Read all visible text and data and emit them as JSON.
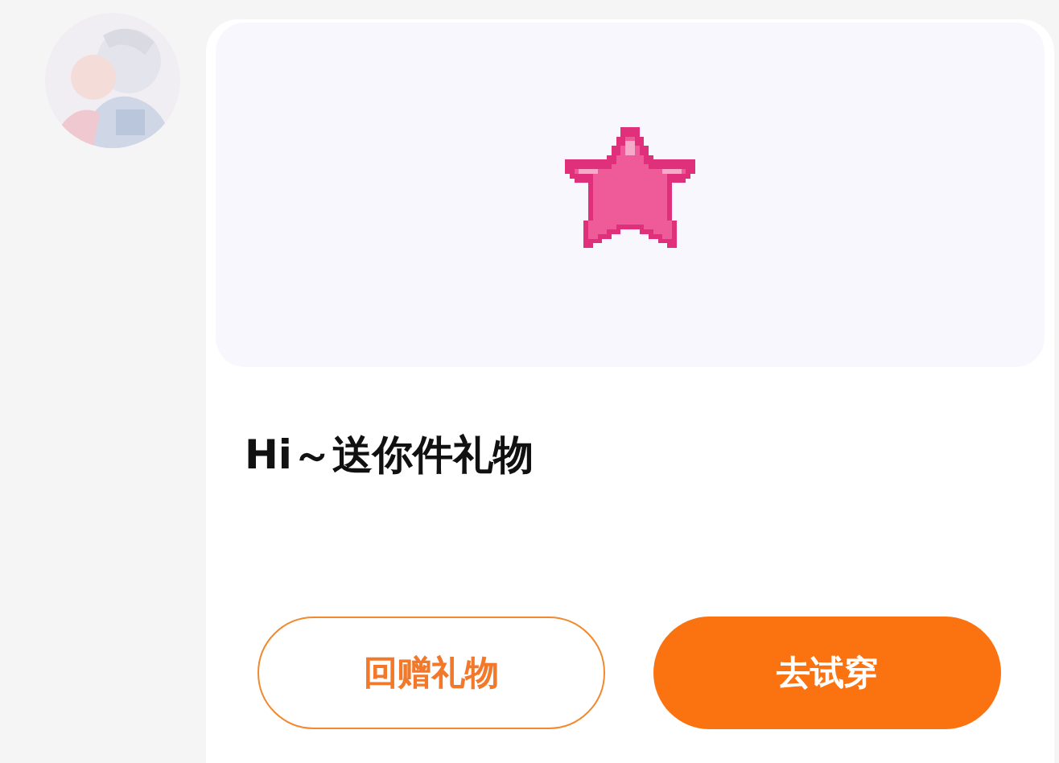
{
  "message": "Hi～送你件礼物",
  "buttons": [
    {
      "label": "回赠礼物",
      "kind": "outline"
    },
    {
      "label": "去试穿",
      "kind": "filled"
    }
  ]
}
